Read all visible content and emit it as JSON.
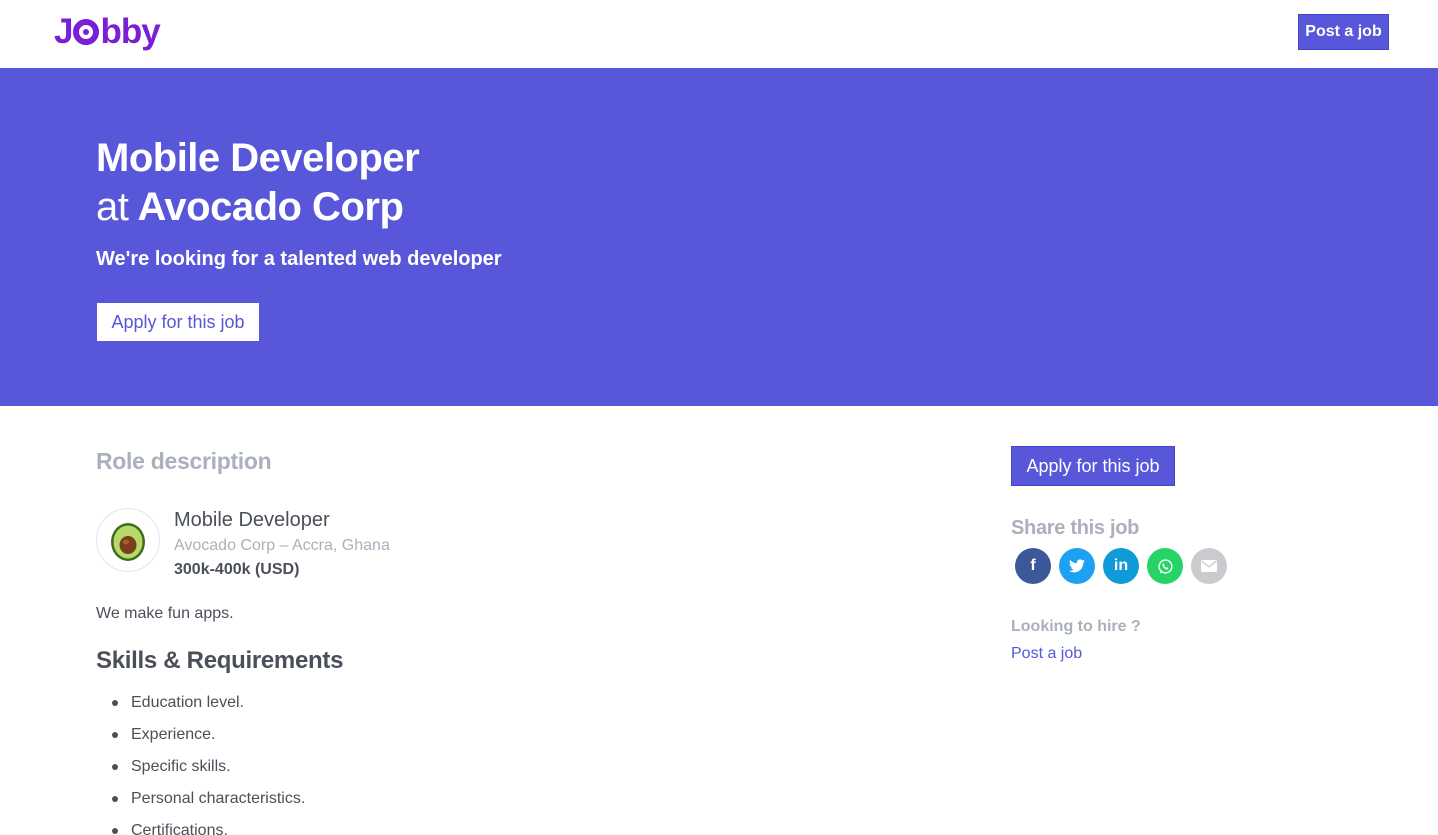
{
  "brand": {
    "name_part1": "J",
    "name_part2": "bby",
    "color": "#7a1fd6"
  },
  "navbar": {
    "post_job_label": "Post a job"
  },
  "hero": {
    "job_title": "Mobile Developer",
    "at_word": "at",
    "company": "Avocado Corp",
    "tagline": "We're looking for a talented web developer",
    "apply_label": "Apply for this job",
    "background": "#5856d9"
  },
  "main": {
    "role_heading": "Role description",
    "job_name": "Mobile Developer",
    "company_location": "Avocado Corp – Accra, Ghana",
    "salary": "300k-400k (USD)",
    "company_description": "We make fun apps.",
    "skills_heading": "Skills & Requirements",
    "skills": [
      "Education level.",
      "Experience.",
      "Specific skills.",
      "Personal characteristics.",
      "Certifications."
    ],
    "company_logo_icon": "avocado-icon"
  },
  "sidebar": {
    "apply_label": "Apply for this job",
    "share_heading": "Share this job",
    "share_buttons": [
      {
        "name": "facebook",
        "glyph": "f",
        "color": "#3b5998"
      },
      {
        "name": "twitter",
        "glyph": "",
        "color": "#1da1f2"
      },
      {
        "name": "linkedin",
        "glyph": "in",
        "color": "#0e9bd8"
      },
      {
        "name": "whatsapp",
        "glyph": "",
        "color": "#25d366"
      },
      {
        "name": "email",
        "glyph": "",
        "color": "#c9cbcf"
      }
    ],
    "hire_label": "Looking to hire ?",
    "hire_link": "Post a job"
  }
}
